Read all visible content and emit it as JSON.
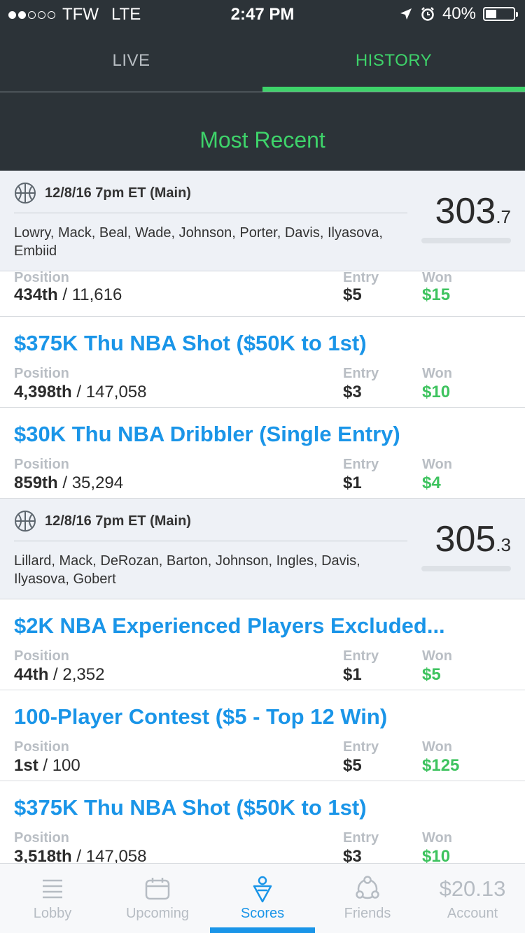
{
  "status_bar": {
    "signal_dots": [
      true,
      true,
      false,
      false,
      false
    ],
    "carrier": "TFW",
    "network": "LTE",
    "time": "2:47 PM",
    "battery_percent": "40%",
    "battery_level": 0.4
  },
  "tabs": [
    {
      "label": "LIVE",
      "active": false
    },
    {
      "label": "HISTORY",
      "active": true
    }
  ],
  "section_title": "Most Recent",
  "labels": {
    "position": "Position",
    "entry": "Entry",
    "won": "Won"
  },
  "groups": [
    {
      "date": "12/8/16 7pm ET (Main)",
      "players": "Lowry, Mack, Beal, Wade, Johnson, Porter, Davis, Ilyasova, Embiid",
      "score_int": "303",
      "score_dec": ".7",
      "contests": [
        {
          "title": "",
          "rank": "434th",
          "total": "/ 11,616",
          "entry": "$5",
          "won": "$15"
        },
        {
          "title": "$375K Thu NBA Shot ($50K to 1st)",
          "rank": "4,398th",
          "total": "/ 147,058",
          "entry": "$3",
          "won": "$10"
        },
        {
          "title": "$30K Thu NBA Dribbler (Single Entry)",
          "rank": "859th",
          "total": "/ 35,294",
          "entry": "$1",
          "won": "$4"
        }
      ]
    },
    {
      "date": "12/8/16 7pm ET (Main)",
      "players": "Lillard, Mack, DeRozan, Barton, Johnson, Ingles, Davis, Ilyasova, Gobert",
      "score_int": "305",
      "score_dec": ".3",
      "contests": [
        {
          "title": "$2K NBA Experienced Players Excluded...",
          "rank": "44th",
          "total": "/ 2,352",
          "entry": "$1",
          "won": "$5"
        },
        {
          "title": "100-Player Contest ($5 - Top 12 Win)",
          "rank": "1st",
          "total": "/ 100",
          "entry": "$5",
          "won": "$125"
        },
        {
          "title": "$375K Thu NBA Shot ($50K to 1st)",
          "rank": "3,518th",
          "total": "/ 147,058",
          "entry": "$3",
          "won": "$10"
        }
      ]
    }
  ],
  "bottom_nav": {
    "items": [
      {
        "label": "Lobby",
        "icon": "list-icon"
      },
      {
        "label": "Upcoming",
        "icon": "calendar-icon"
      },
      {
        "label": "Scores",
        "icon": "trophy-icon",
        "active": true
      },
      {
        "label": "Friends",
        "icon": "friends-icon"
      },
      {
        "label": "Account",
        "icon": "balance"
      }
    ],
    "balance": "$20.13"
  },
  "colors": {
    "header_bg": "#2c3338",
    "accent_green": "#3ed36a",
    "link_blue": "#1a95e8",
    "won_green": "#3ec35f"
  }
}
